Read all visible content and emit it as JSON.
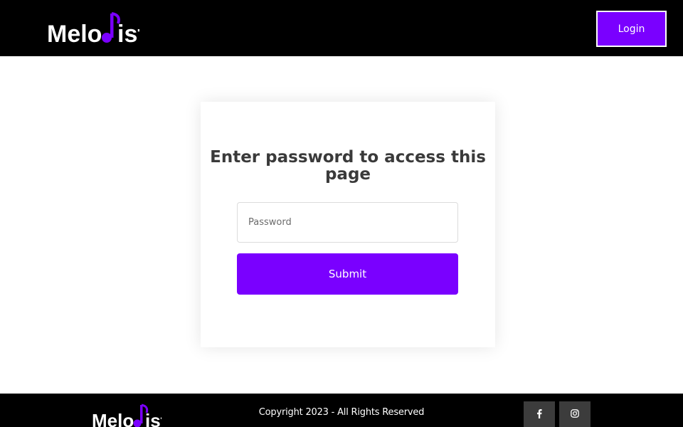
{
  "header": {
    "logo_alt": "Melodist",
    "login_label": "Login"
  },
  "card": {
    "title": "Enter password to access this page",
    "password_placeholder": "Password",
    "submit_label": "Submit"
  },
  "footer": {
    "logo_alt": "Melodist",
    "copyright": "Copyright 2023 - All Rights Reserved",
    "social": [
      {
        "icon": "facebook-icon"
      },
      {
        "icon": "instagram-icon"
      }
    ]
  },
  "colors": {
    "accent": "#7a00ff",
    "bar": "#000000",
    "social_bg": "#3c3c3c"
  }
}
